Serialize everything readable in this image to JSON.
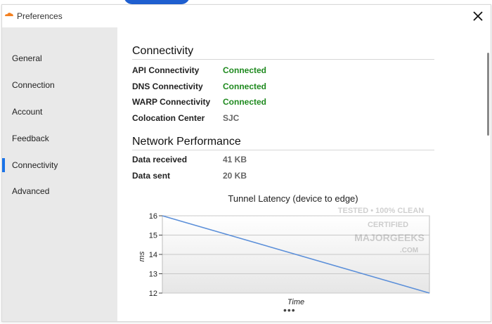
{
  "window": {
    "title": "Preferences"
  },
  "sidebar": {
    "items": [
      {
        "label": "General"
      },
      {
        "label": "Connection"
      },
      {
        "label": "Account"
      },
      {
        "label": "Feedback"
      },
      {
        "label": "Connectivity",
        "active": true
      },
      {
        "label": "Advanced"
      }
    ]
  },
  "connectivity": {
    "title": "Connectivity",
    "rows": [
      {
        "label": "API Connectivity",
        "value": "Connected"
      },
      {
        "label": "DNS Connectivity",
        "value": "Connected"
      },
      {
        "label": "WARP Connectivity",
        "value": "Connected"
      },
      {
        "label": "Colocation Center",
        "value": "SJC"
      }
    ]
  },
  "network": {
    "title": "Network Performance",
    "rows": [
      {
        "label": "Data received",
        "value": "41 KB"
      },
      {
        "label": "Data sent",
        "value": "20 KB"
      }
    ]
  },
  "chart_data": {
    "type": "line",
    "title": "Tunnel Latency (device to edge)",
    "xlabel": "Time",
    "ylabel": "ms",
    "ylim": [
      12,
      16
    ],
    "yticks": [
      "16",
      "15",
      "14",
      "13",
      "12"
    ],
    "series": [
      {
        "values": [
          16,
          12
        ]
      }
    ],
    "grid": true
  },
  "more": {
    "label": "•••"
  },
  "watermark": {
    "lines": [
      "TESTED • 100% CLEAN",
      "CERTIFIED",
      "MAJORGEEKS",
      ".COM"
    ]
  },
  "colors": {
    "accent": "#1a73e8",
    "connected": "#1f8a1f",
    "line": "#5b8fd9"
  },
  "icons": {
    "app": "cloudflare-logo-icon",
    "close": "close-icon"
  }
}
